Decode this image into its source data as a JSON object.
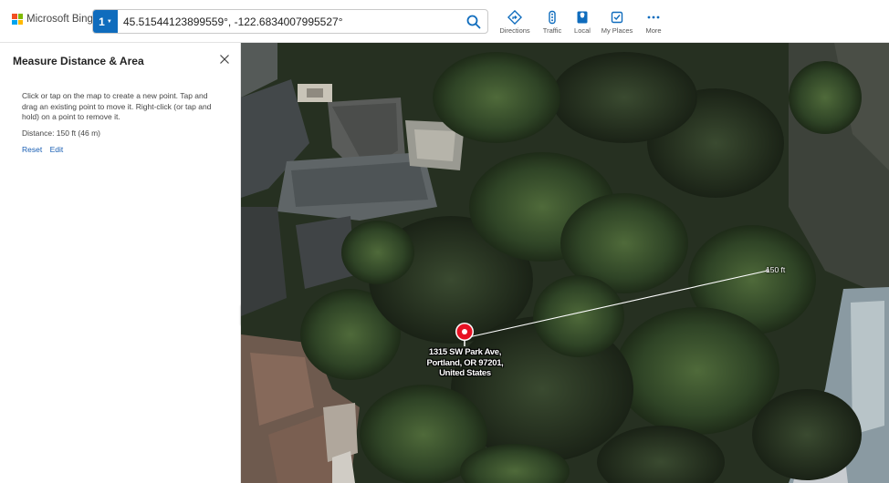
{
  "brand": {
    "name": "Microsoft Bing",
    "logo_colors": [
      "#f25022",
      "#7fba00",
      "#00a4ef",
      "#ffb900"
    ]
  },
  "search": {
    "index_label": "1",
    "value": "45.51544123899559°, -122.6834007995527°",
    "accent": "#0f6cbd"
  },
  "nav": [
    {
      "label": "Directions",
      "icon": "directions-icon"
    },
    {
      "label": "Traffic",
      "icon": "traffic-icon"
    },
    {
      "label": "Local",
      "icon": "local-icon"
    },
    {
      "label": "My Places",
      "icon": "my-places-icon"
    },
    {
      "label": "More",
      "icon": "more-icon"
    }
  ],
  "panel": {
    "title": "Measure Distance & Area",
    "description": "Click or tap on the map to create a new point. Tap and drag an existing point to move it. Right-click (or tap and hold) on a point to remove it.",
    "distance": "Distance: 150 ft (46 m)",
    "actions": {
      "reset": "Reset",
      "edit": "Edit"
    }
  },
  "map": {
    "pin_address_lines": [
      "1315 SW Park Ave,",
      "Portland, OR 97201,",
      "United States"
    ],
    "measure_label": "150 ft",
    "pin_color": "#e81123",
    "view": "aerial"
  }
}
